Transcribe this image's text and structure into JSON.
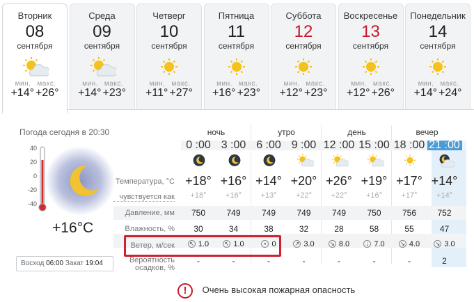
{
  "days": [
    {
      "name": "Вторник",
      "date": "08",
      "month": "сентября",
      "min_label": "мин.",
      "max_label": "макс.",
      "min": "+14°",
      "max": "+26°",
      "weekend": false,
      "icon": "partly-cloudy-icon",
      "active": true
    },
    {
      "name": "Среда",
      "date": "09",
      "month": "сентября",
      "min_label": "мин.",
      "max_label": "макс.",
      "min": "+14°",
      "max": "+23°",
      "weekend": false,
      "icon": "partly-cloudy-icon",
      "active": false
    },
    {
      "name": "Четверг",
      "date": "10",
      "month": "сентября",
      "min_label": "мин.",
      "max_label": "макс.",
      "min": "+11°",
      "max": "+27°",
      "weekend": false,
      "icon": "sun-icon",
      "active": false
    },
    {
      "name": "Пятница",
      "date": "11",
      "month": "сентября",
      "min_label": "мин.",
      "max_label": "макс.",
      "min": "+16°",
      "max": "+23°",
      "weekend": false,
      "icon": "sun-icon",
      "active": false
    },
    {
      "name": "Суббота",
      "date": "12",
      "month": "сентября",
      "min_label": "мин.",
      "max_label": "макс.",
      "min": "+12°",
      "max": "+23°",
      "weekend": true,
      "icon": "sun-icon",
      "active": false
    },
    {
      "name": "Воскресенье",
      "date": "13",
      "month": "сентября",
      "min_label": "мин.",
      "max_label": "макс.",
      "min": "+12°",
      "max": "+26°",
      "weekend": true,
      "icon": "sun-icon",
      "active": false
    },
    {
      "name": "Понедельник",
      "date": "14",
      "month": "сентября",
      "min_label": "мин.",
      "max_label": "макс.",
      "min": "+14°",
      "max": "+24°",
      "weekend": false,
      "icon": "sun-icon",
      "active": false
    }
  ],
  "current": {
    "title": "Погода сегодня в 20:30",
    "temp": "+16°C",
    "scale": [
      "40",
      "20",
      "0",
      "-20",
      "-40"
    ],
    "sunrise_label": "Восход",
    "sunrise": "06:00",
    "sunset_label": "Закат",
    "sunset": "19:04",
    "icon": "moon-night-icon"
  },
  "periods": [
    "ночь",
    "утро",
    "день",
    "вечер"
  ],
  "hours": [
    "0 :00",
    "3 :00",
    "6 :00",
    "9 :00",
    "12 :00",
    "15 :00",
    "18 :00",
    "21 :00"
  ],
  "hour_icons": [
    "moon-icon",
    "moon-icon",
    "moon-icon",
    "partly-cloudy-icon",
    "sun-cloud-icon",
    "sun-cloud-icon",
    "sun-icon",
    "cloudy-moon-icon"
  ],
  "rows": {
    "temperature": {
      "label": "Температура, °С",
      "values": [
        "+18°",
        "+16°",
        "+14°",
        "+20°",
        "+26°",
        "+19°",
        "+17°",
        "+14°"
      ]
    },
    "feels": {
      "label": "чувствуется как",
      "values": [
        "+18°",
        "+16°",
        "+13°",
        "+22°",
        "+22°",
        "+16°",
        "+17°",
        "+14°"
      ]
    },
    "pressure": {
      "label": "Давление, мм",
      "values": [
        "750",
        "749",
        "749",
        "749",
        "749",
        "750",
        "756",
        "752"
      ]
    },
    "humidity": {
      "label": "Влажность, %",
      "values": [
        "30",
        "34",
        "38",
        "32",
        "28",
        "58",
        "55",
        "47"
      ]
    },
    "wind": {
      "label": "Ветер, м/сек",
      "values": [
        "1.0",
        "1.0",
        "0",
        "3.0",
        "8.0",
        "7.0",
        "4.0",
        "3.0"
      ],
      "dirs": [
        "↖",
        "↖",
        "•",
        "↗",
        "↘",
        "↓",
        "↘",
        "↘"
      ]
    },
    "precip": {
      "label": "Вероятность осадков, %",
      "values": [
        "-",
        "-",
        "-",
        "-",
        "-",
        "-",
        "-",
        "2"
      ]
    }
  },
  "alert": {
    "icon": "exclamation-icon",
    "symbol": "!",
    "text": "Очень высокая пожарная опасность"
  },
  "colors": {
    "weekend": "#c7182c",
    "current_hour": "#4a9bd6",
    "highlight": "#d01f2f"
  }
}
